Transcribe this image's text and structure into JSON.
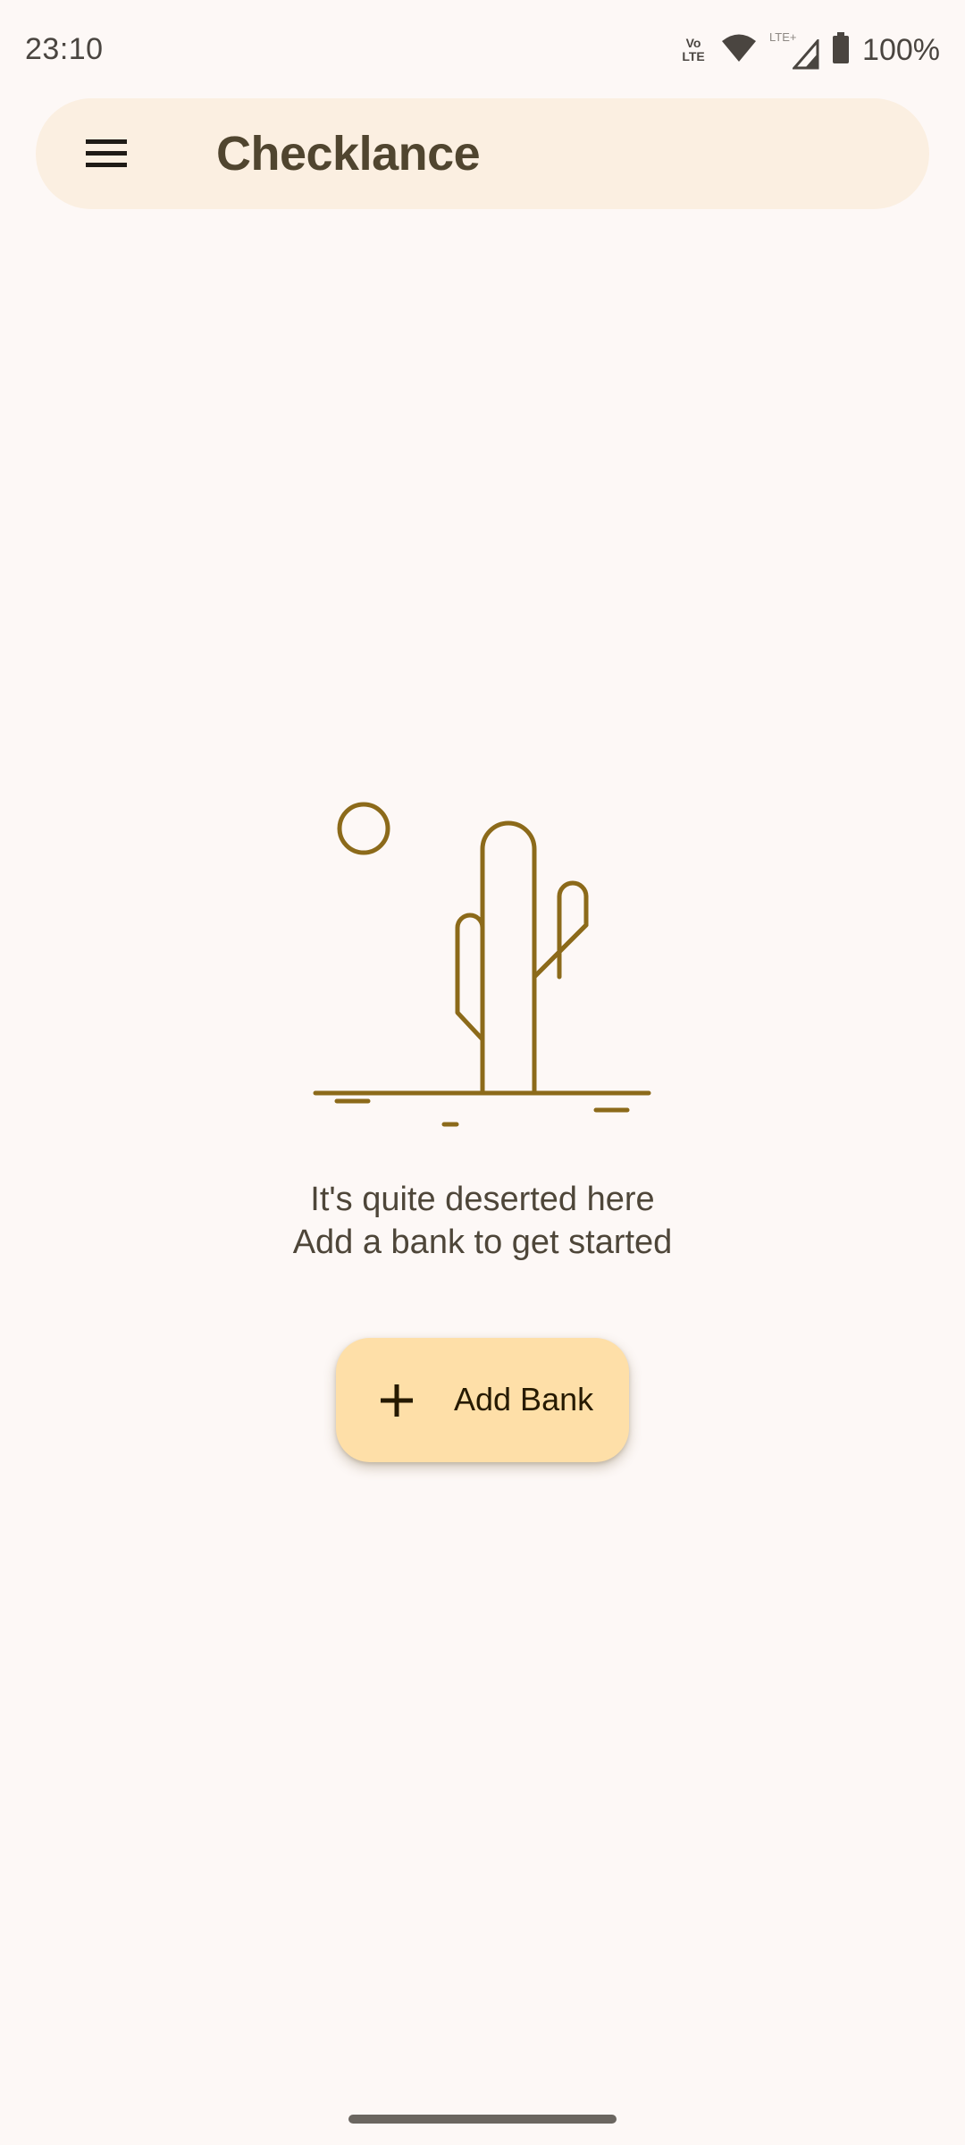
{
  "status_bar": {
    "time": "23:10",
    "volte_line1": "Vo",
    "volte_line2": "LTE",
    "network_label": "LTE+",
    "battery": "100%",
    "icons": [
      "volte-icon",
      "wifi-icon",
      "signal-icon",
      "battery-icon"
    ]
  },
  "top_bar": {
    "title": "Checklance",
    "menu_icon": "hamburger-menu-icon"
  },
  "empty_state": {
    "illustration": "cactus-desert-icon",
    "line1": "It's quite deserted here",
    "line2": "Add a bank to get started"
  },
  "add_bank_button": {
    "label": "Add Bank",
    "icon": "plus-icon"
  },
  "colors": {
    "background": "#fdf8f6",
    "top_bar": "#fbefe1",
    "accent": "#8c6a1a",
    "button": "#fedfa8"
  }
}
